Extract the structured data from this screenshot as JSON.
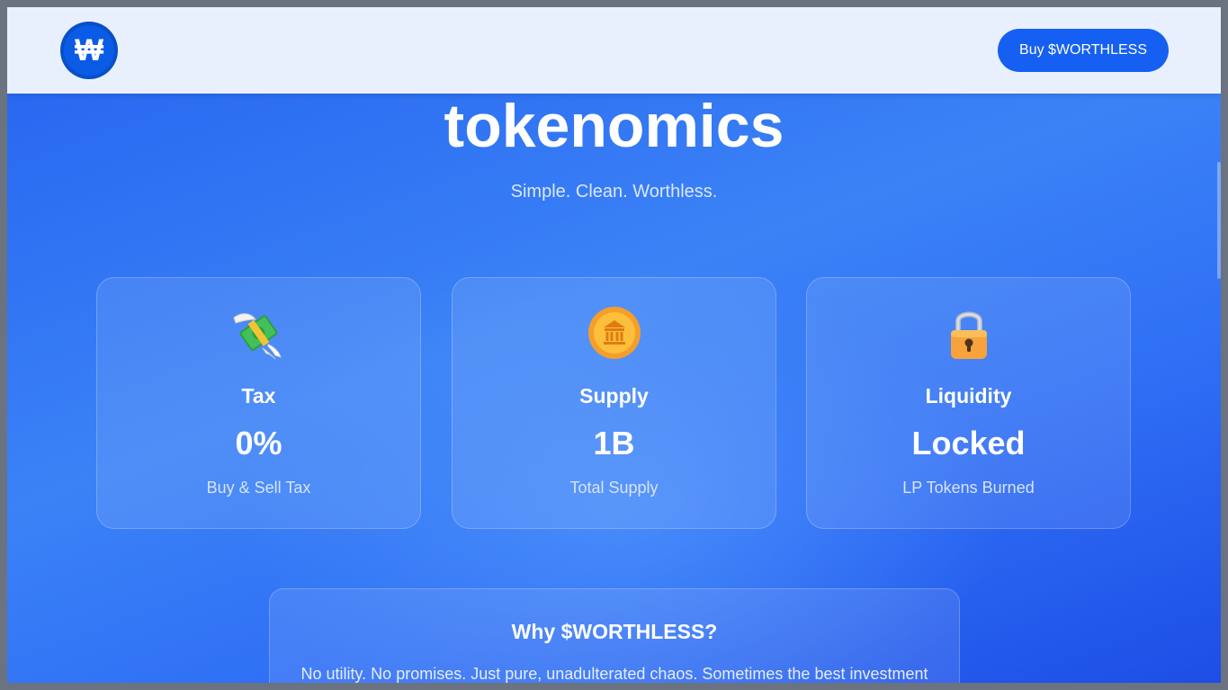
{
  "header": {
    "logo_glyph": "₩",
    "buy_button_label": "Buy $WORTHLESS"
  },
  "hero": {
    "title": "tokenomics",
    "subtitle": "Simple. Clean. Worthless."
  },
  "cards": [
    {
      "icon": "money-with-wings-icon",
      "label": "Tax",
      "value": "0%",
      "caption": "Buy & Sell Tax"
    },
    {
      "icon": "bank-coin-icon",
      "label": "Supply",
      "value": "1B",
      "caption": "Total Supply"
    },
    {
      "icon": "padlock-icon",
      "label": "Liquidity",
      "value": "Locked",
      "caption": "LP Tokens Burned"
    }
  ],
  "why": {
    "title": "Why $WORTHLESS?",
    "text": "No utility. No promises. Just pure, unadulterated chaos. Sometimes the best investment"
  },
  "colors": {
    "accent": "#1560f2",
    "header_bg": "#e9f0fd",
    "page_bg": "#2f6ff5"
  }
}
